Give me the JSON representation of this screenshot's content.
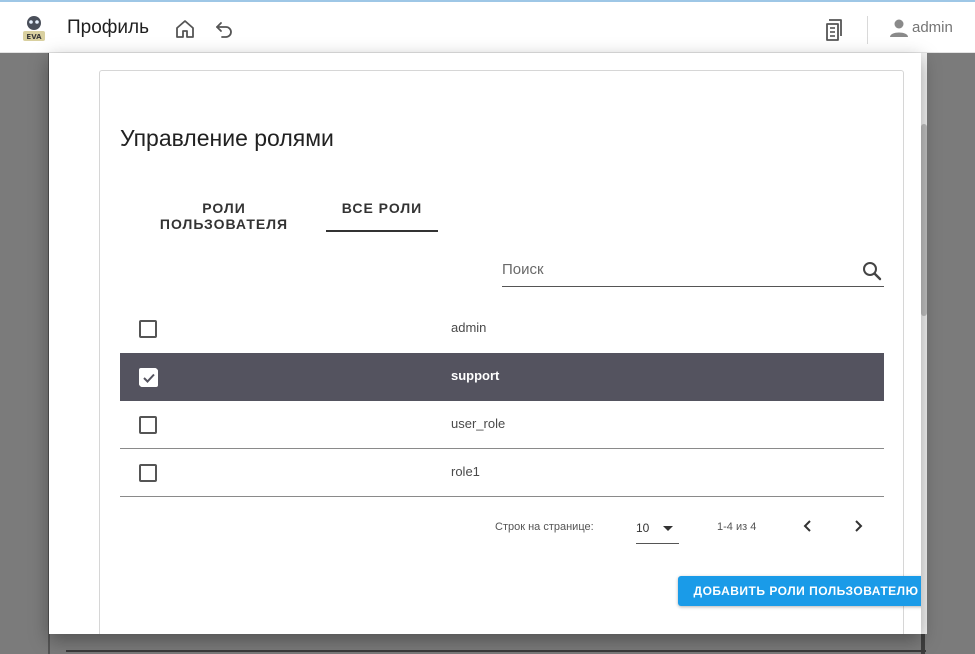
{
  "header": {
    "title": "Профиль",
    "user": "admin",
    "icons": [
      "robot-logo",
      "home-icon",
      "undo-icon",
      "document-icon",
      "user-icon"
    ]
  },
  "dialog": {
    "title": "Управление ролями",
    "tabs": [
      {
        "label": "РОЛИ ПОЛЬЗОВАТЕЛЯ",
        "active": false
      },
      {
        "label": "ВСЕ РОЛИ",
        "active": true
      }
    ],
    "search": {
      "placeholder": "Поиск",
      "value": ""
    },
    "roles": [
      {
        "name": "admin",
        "checked": false
      },
      {
        "name": "support",
        "checked": true
      },
      {
        "name": "user_role",
        "checked": false
      },
      {
        "name": "role1",
        "checked": false
      }
    ],
    "pagination": {
      "rows_per_page_label": "Строк на странице:",
      "rows_per_page": "10",
      "range": "1-4 из 4"
    },
    "add_button": "ДОБАВИТЬ РОЛИ ПОЛЬЗОВАТЕЛЮ"
  },
  "colors": {
    "accent": "#1a9be8",
    "selected_row": "#54535f"
  }
}
